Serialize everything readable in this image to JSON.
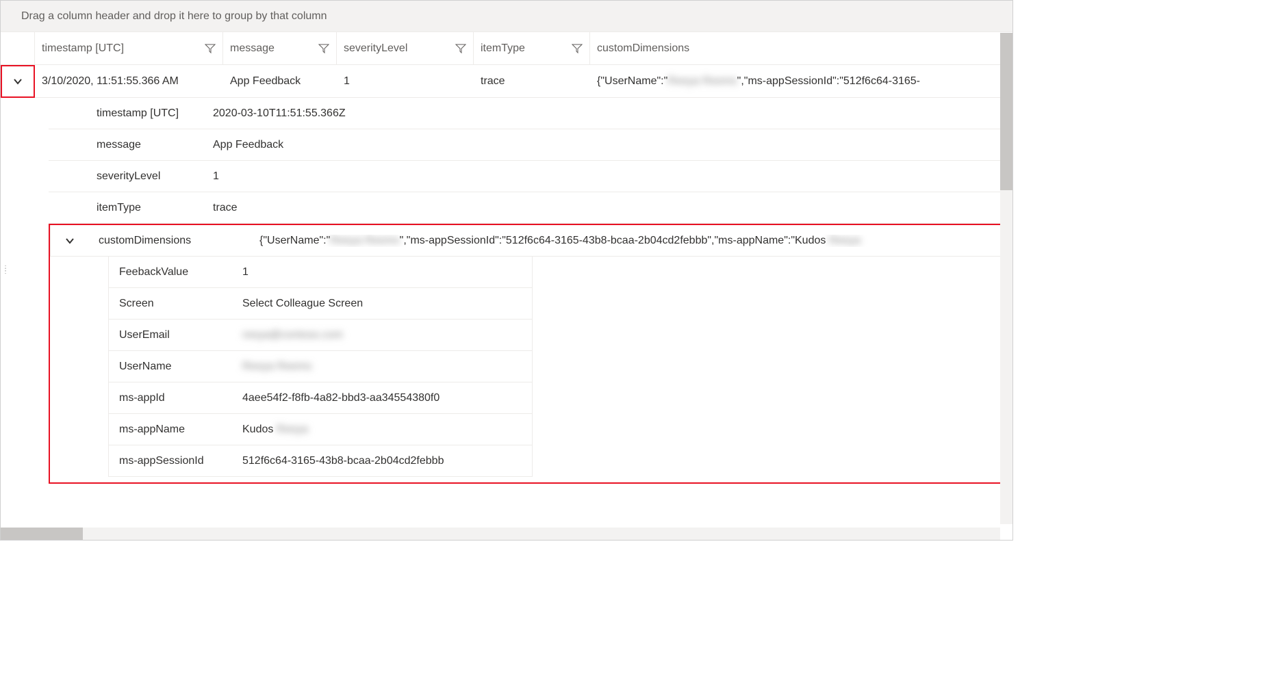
{
  "groupBar": {
    "hint": "Drag a column header and drop it here to group by that column"
  },
  "columns": {
    "timestamp": "timestamp [UTC]",
    "message": "message",
    "severity": "severityLevel",
    "itemType": "itemType",
    "custom": "customDimensions"
  },
  "row": {
    "timestamp": "3/10/2020, 11:51:55.366 AM",
    "message": "App Feedback",
    "severity": "1",
    "itemType": "trace",
    "customPrefix": "{\"UserName\":\"",
    "customRedacted": "Reeya Reems",
    "customSuffix": "\",\"ms-appSessionId\":\"512f6c64-3165-"
  },
  "details": {
    "timestamp": {
      "key": "timestamp [UTC]",
      "val": "2020-03-10T11:51:55.366Z"
    },
    "message": {
      "key": "message",
      "val": "App Feedback"
    },
    "severity": {
      "key": "severityLevel",
      "val": "1"
    },
    "itemType": {
      "key": "itemType",
      "val": "trace"
    }
  },
  "customDim": {
    "key": "customDimensions",
    "prefix": "{\"UserName\":\"",
    "redacted1": "Reeya Reems",
    "mid": "\",\"ms-appSessionId\":\"512f6c64-3165-43b8-bcaa-2b04cd2febbb\",\"ms-appName\":\"Kudos ",
    "redacted2": "Reeya"
  },
  "sub": {
    "feedback": {
      "key": "FeebackValue",
      "val": "1"
    },
    "screen": {
      "key": "Screen",
      "val": "Select Colleague Screen"
    },
    "userEmail": {
      "key": "UserEmail",
      "valRedacted": "reeya@contoso.com"
    },
    "userName": {
      "key": "UserName",
      "valRedacted": "Reeya Reems"
    },
    "appId": {
      "key": "ms-appId",
      "val": "4aee54f2-f8fb-4a82-bbd3-aa34554380f0"
    },
    "appName": {
      "key": "ms-appName",
      "valPrefix": "Kudos ",
      "valRedacted": "Reeya"
    },
    "appSession": {
      "key": "ms-appSessionId",
      "val": "512f6c64-3165-43b8-bcaa-2b04cd2febbb"
    }
  }
}
